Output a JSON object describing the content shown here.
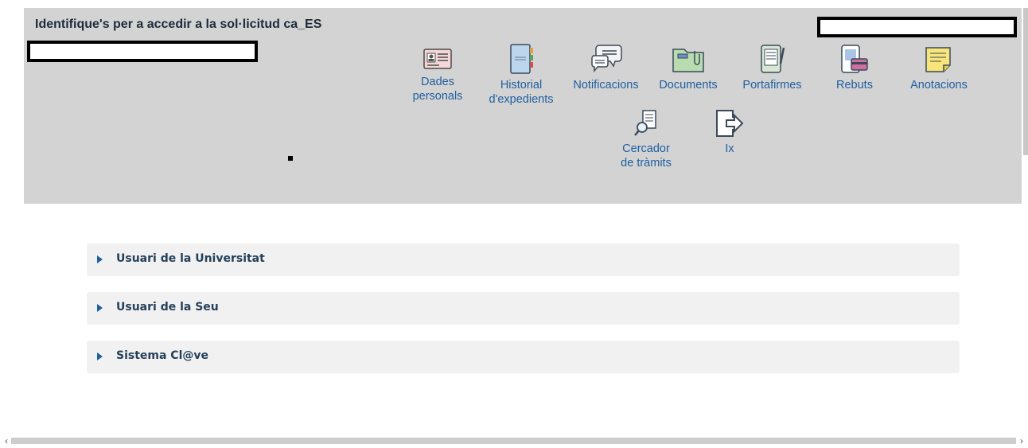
{
  "header": {
    "title": "Identifique's per a accedir a la sol·licitud ca_ES"
  },
  "nav": {
    "dades": "Dades personals",
    "dades_l1": "Dades",
    "dades_l2": "personals",
    "historial_l1": "Historial",
    "historial_l2": "d'expedients",
    "notificacions": "Notificacions",
    "documents": "Documents",
    "portafirmes": "Portafirmes",
    "rebuts": "Rebuts",
    "anotacions": "Anotacions",
    "cercador_l1": "Cercador",
    "cercador_l2": "de tràmits",
    "ix": "Ix"
  },
  "panels": [
    {
      "label": "Usuari de la Universitat"
    },
    {
      "label": "Usuari de la Seu"
    },
    {
      "label": "Sistema Cl@ve"
    }
  ],
  "scrollbar": {
    "left": "‹",
    "right": "›"
  }
}
